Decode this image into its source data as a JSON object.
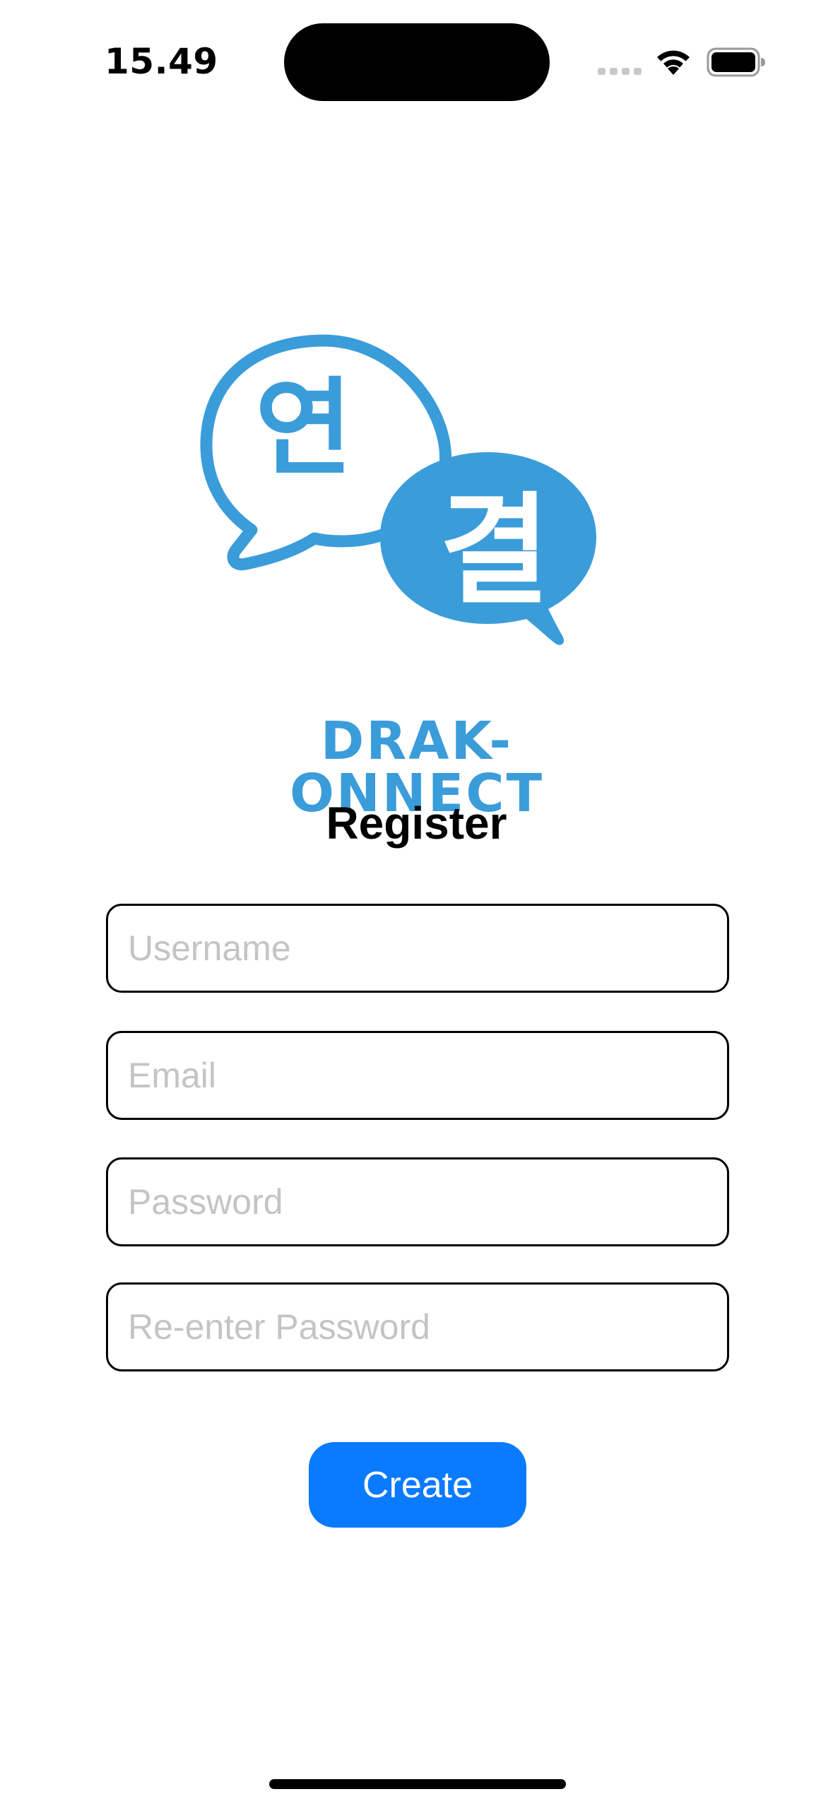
{
  "status_bar": {
    "time": "15.49",
    "icons": [
      "cellular-signal-icon",
      "wifi-icon",
      "battery-icon"
    ]
  },
  "logo": {
    "glyph_left": "연",
    "glyph_right": "결",
    "wordmark": "DRAK-ONNECT",
    "color": "#3b9cda"
  },
  "page": {
    "title": "Register"
  },
  "form": {
    "username_placeholder": "Username",
    "username_value": "",
    "email_placeholder": "Email",
    "email_value": "",
    "password_placeholder": "Password",
    "password_value": "",
    "reenter_placeholder": "Re-enter Password",
    "reenter_value": ""
  },
  "actions": {
    "create_label": "Create",
    "accent": "#0a7aff"
  }
}
